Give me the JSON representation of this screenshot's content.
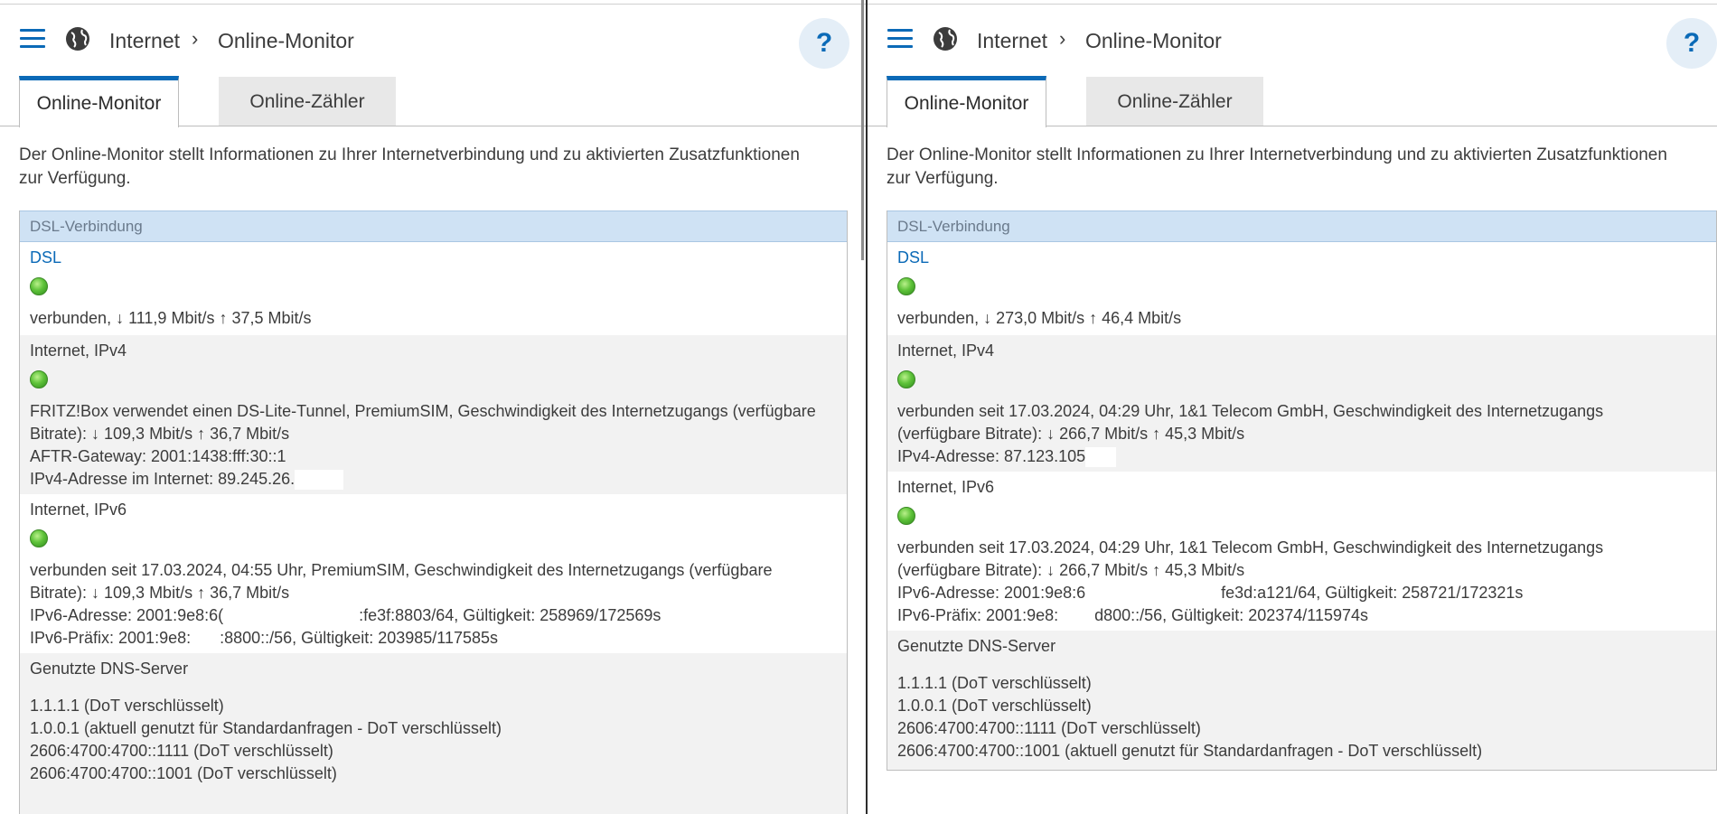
{
  "left": {
    "breadcrumb": {
      "section": "Internet",
      "page": "Online-Monitor"
    },
    "help_label": "?",
    "tabs": [
      {
        "label": "Online-Monitor",
        "active": true
      },
      {
        "label": "Online-Zähler",
        "active": false
      }
    ],
    "intro_line1": "Der Online-Monitor stellt Informationen zu Ihrer Internetverbindung und zu aktivierten Zusatzfunktionen",
    "intro_line2": "zur Verfügung.",
    "table_header": "DSL-Verbindung",
    "dsl": {
      "title": "DSL",
      "status": "verbunden, ↓ 111,9 Mbit/s ↑ 37,5 Mbit/s"
    },
    "ipv4": {
      "title": "Internet, IPv4",
      "line1": "FRITZ!Box verwendet einen DS-Lite-Tunnel, PremiumSIM, Geschwindigkeit des Internetzugangs (verfügbare",
      "line2": "Bitrate): ↓ 109,3 Mbit/s ↑ 36,7 Mbit/s",
      "line3": "AFTR-Gateway: 2001:1438:fff:30::1",
      "line4": "IPv4-Adresse im Internet: 89.245.26."
    },
    "ipv6": {
      "title": "Internet, IPv6",
      "line1": "verbunden seit 17.03.2024, 04:55 Uhr, PremiumSIM, Geschwindigkeit des Internetzugangs (verfügbare",
      "line2": "Bitrate): ↓ 109,3 Mbit/s ↑ 36,7 Mbit/s",
      "addr_prefix": "IPv6-Adresse: 2001:9e8:6(",
      "addr_suffix": ":fe3f:8803/64, Gültigkeit: 258969/172569s",
      "praefix_prefix": "IPv6-Präfix: 2001:9e8:",
      "praefix_suffix": ":8800::/56, Gültigkeit: 203985/117585s"
    },
    "dns": {
      "title": "Genutzte DNS-Server",
      "servers": [
        "1.1.1.1 (DoT verschlüsselt)",
        "1.0.0.1 (aktuell genutzt für Standardanfragen - DoT verschlüsselt)",
        "2606:4700:4700::1111 (DoT verschlüsselt)",
        "2606:4700:4700::1001 (DoT verschlüsselt)"
      ]
    }
  },
  "right": {
    "breadcrumb": {
      "section": "Internet",
      "page": "Online-Monitor"
    },
    "help_label": "?",
    "tabs": [
      {
        "label": "Online-Monitor",
        "active": true
      },
      {
        "label": "Online-Zähler",
        "active": false
      }
    ],
    "intro_line1": "Der Online-Monitor stellt Informationen zu Ihrer Internetverbindung und zu aktivierten Zusatzfunktionen",
    "intro_line2": "zur Verfügung.",
    "table_header": "DSL-Verbindung",
    "dsl": {
      "title": "DSL",
      "status": "verbunden, ↓ 273,0 Mbit/s ↑ 46,4 Mbit/s"
    },
    "ipv4": {
      "title": "Internet, IPv4",
      "line1": "verbunden seit 17.03.2024, 04:29 Uhr, 1&1 Telecom GmbH, Geschwindigkeit des Internetzugangs",
      "line2": "(verfügbare Bitrate): ↓ 266,7 Mbit/s ↑ 45,3 Mbit/s",
      "line3": "IPv4-Adresse: 87.123.105"
    },
    "ipv6": {
      "title": "Internet, IPv6",
      "line1": "verbunden seit 17.03.2024, 04:29 Uhr, 1&1 Telecom GmbH, Geschwindigkeit des Internetzugangs",
      "line2": "(verfügbare Bitrate): ↓ 266,7 Mbit/s ↑ 45,3 Mbit/s",
      "addr_prefix": "IPv6-Adresse: 2001:9e8:6",
      "addr_suffix": "fe3d:a121/64, Gültigkeit: 258721/172321s",
      "praefix_prefix": "IPv6-Präfix: 2001:9e8:",
      "praefix_suffix": "d800::/56, Gültigkeit: 202374/115974s"
    },
    "dns": {
      "title": "Genutzte DNS-Server",
      "servers": [
        "1.1.1.1 (DoT verschlüsselt)",
        "1.0.0.1 (DoT verschlüsselt)",
        "2606:4700:4700::1111 (DoT verschlüsselt)",
        "2606:4700:4700::1001 (aktuell genutzt für Standardanfragen - DoT verschlüsselt)"
      ]
    }
  },
  "colors": {
    "accent": "#0b6ab7",
    "header_bg": "#cfe2f4",
    "led_green": "#5fc33a",
    "tab_inactive": "#e8e8e8",
    "row_alt": "#f2f2f2"
  },
  "icons": [
    "menu-icon",
    "globe-icon",
    "chevron-right-icon",
    "help-icon",
    "status-led-icon"
  ]
}
